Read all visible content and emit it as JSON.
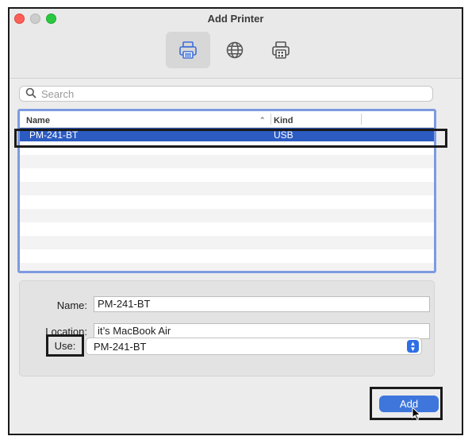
{
  "window": {
    "title": "Add Printer"
  },
  "toolbar": [
    {
      "icon": "default-printer-icon",
      "active": true
    },
    {
      "icon": "ip-globe-icon",
      "active": false
    },
    {
      "icon": "windows-printer-icon",
      "active": false
    }
  ],
  "search": {
    "placeholder": "Search",
    "value": ""
  },
  "list": {
    "columns": {
      "name": "Name",
      "kind": "Kind",
      "sort": "ascending"
    },
    "rows": [
      {
        "name": "PM-241-BT",
        "kind": "USB",
        "selected": true
      }
    ]
  },
  "form": {
    "name_label": "Name:",
    "name_value": "PM-241-BT",
    "location_label": "Location:",
    "location_value": "it’s MacBook Air",
    "use_label": "Use:",
    "use_value": "PM-241-BT"
  },
  "actions": {
    "add_label": "Add"
  },
  "colors": {
    "accent": "#2c5bc2",
    "button": "#3e76dc",
    "list_border": "#7d9ae0"
  }
}
